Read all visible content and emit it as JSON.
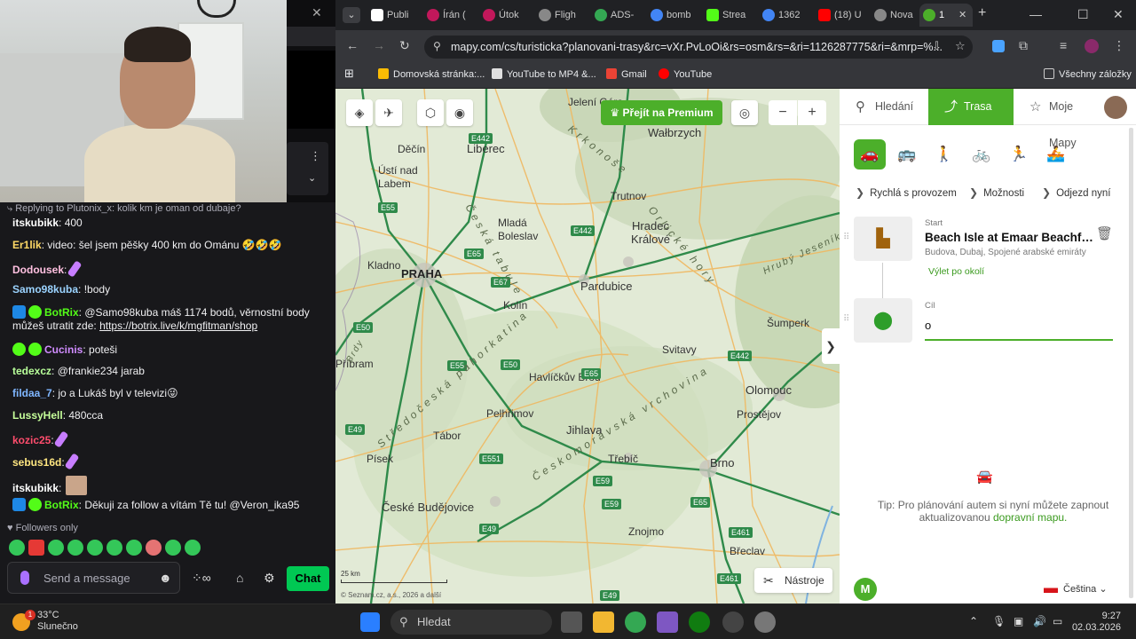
{
  "chat": {
    "reply_context": "Replying to Plutonix_x: kolik km je oman od dubaje?",
    "messages": [
      {
        "user": "itskubikk",
        "color": "#ffffff",
        "text": "400"
      },
      {
        "user": "Er1lik",
        "color": "#ffd966",
        "text": "video: šel jsem pěšky 400 km do Ománu 🤣🤣🤣"
      },
      {
        "user": "Dodousek",
        "color": "#ffc0e0",
        "text": ""
      },
      {
        "user": "Samo98kuba",
        "color": "#9bd3ff",
        "text": "!body"
      },
      {
        "user": "BotRix",
        "color": "#53fc18",
        "text": "@Samo98kuba máš 1174 bodů, věrnostní body můžeš utratit zde:",
        "link": "https://botrix.live/k/mgfitman/shop"
      },
      {
        "user": "Cucinis",
        "color": "#d08cff",
        "text": "poteši"
      },
      {
        "user": "tedexcz",
        "color": "#b8ff9a",
        "text": "@frankie234 jarab"
      },
      {
        "user": "fildaa_7",
        "color": "#7fb6ff",
        "text": "jo a Lukáš byl v televizi😜"
      },
      {
        "user": "LussyHell",
        "color": "#c6ff9a",
        "text": "480cca"
      },
      {
        "user": "kozic25",
        "color": "#ff4d6d",
        "text": ""
      },
      {
        "user": "sebus16d",
        "color": "#ffe680",
        "text": ""
      },
      {
        "user": "itskubikk",
        "color": "#ffffff",
        "text": ""
      },
      {
        "user": "BotRix",
        "color": "#53fc18",
        "text": "Děkuji za follow a vítám Tě tu! @Veron_ika95"
      }
    ],
    "followers_only": "Followers only",
    "send_placeholder": "Send a message",
    "chat_button": "Chat"
  },
  "browser": {
    "tabs": [
      {
        "label": "Publi",
        "color": "#ffffff"
      },
      {
        "label": "Írán (",
        "color": "#c2185b"
      },
      {
        "label": "Útok",
        "color": "#c2185b"
      },
      {
        "label": "Fligh",
        "color": "#888888"
      },
      {
        "label": "ADS-",
        "color": "#34a853"
      },
      {
        "label": "bomb",
        "color": "#4285f4"
      },
      {
        "label": "Strea",
        "color": "#53fc18"
      },
      {
        "label": "1362",
        "color": "#4285f4"
      },
      {
        "label": "(18) U",
        "color": "#ff0000"
      },
      {
        "label": "Nova",
        "color": "#888888"
      },
      {
        "label": "1",
        "color": "#4caf2a"
      }
    ],
    "url": "mapy.com/cs/turisticka?planovani-trasy&rc=vXr.PvLoOi&rs=osm&rs=&ri=1126287775&ri=&mrp=%...",
    "bookmarks": [
      "Domovská stránka:...",
      "YouTube to MP4 &...",
      "Gmail",
      "YouTube"
    ],
    "all_bookmarks": "Všechny záložky"
  },
  "map": {
    "premium_label": "Přejít na Premium",
    "tools_label": "Nástroje",
    "copyright": "© Seznam.cz, a.s., 2026 a další",
    "scale": "25 km",
    "cities": [
      {
        "name": "PRAHA",
        "cls": "big"
      },
      {
        "name": "Liberec",
        "cls": "med"
      },
      {
        "name": "Pardubice",
        "cls": "med"
      },
      {
        "name": "Hradec Králové",
        "cls": "med"
      },
      {
        "name": "Olomouc",
        "cls": "med"
      },
      {
        "name": "Jihlava",
        "cls": "med"
      },
      {
        "name": "Brno",
        "cls": "med"
      },
      {
        "name": "České Budějovice",
        "cls": "med"
      },
      {
        "name": "Wałbrzych",
        "cls": "med"
      },
      {
        "name": "Jelení Góra",
        "cls": ""
      },
      {
        "name": "Děčín",
        "cls": ""
      },
      {
        "name": "Ústí nad Labem",
        "cls": ""
      },
      {
        "name": "Mladá Boleslav",
        "cls": ""
      },
      {
        "name": "Trutnov",
        "cls": ""
      },
      {
        "name": "Kladno",
        "cls": ""
      },
      {
        "name": "Kolín",
        "cls": ""
      },
      {
        "name": "Šumperk",
        "cls": ""
      },
      {
        "name": "Svitavy",
        "cls": ""
      },
      {
        "name": "Příbram",
        "cls": ""
      },
      {
        "name": "Havlíčkův Brod",
        "cls": ""
      },
      {
        "name": "Pelhřimov",
        "cls": ""
      },
      {
        "name": "Prostějov",
        "cls": ""
      },
      {
        "name": "Tábor",
        "cls": ""
      },
      {
        "name": "Písek",
        "cls": ""
      },
      {
        "name": "Třebíč",
        "cls": ""
      },
      {
        "name": "Znojmo",
        "cls": ""
      },
      {
        "name": "Břeclav",
        "cls": ""
      }
    ],
    "roads": [
      "E442",
      "E55",
      "E65",
      "E67",
      "E442",
      "E50",
      "E55",
      "E50",
      "E65",
      "E442",
      "E49",
      "E551",
      "E59",
      "E49",
      "E59",
      "E461",
      "E461",
      "E49",
      "E65"
    ],
    "regions": [
      "Krkonoše",
      "Orlické hory",
      "Hrubý Jeseník",
      "Česká tabule",
      "Českomoravská vrchovina",
      "Brdy",
      "Středočeská pahorkatina"
    ]
  },
  "panel": {
    "tabs": [
      "Hledání",
      "Trasa",
      "Moje Mapy"
    ],
    "options": [
      "Rychlá s provozem",
      "Možnosti",
      "Odjezd nyní"
    ],
    "start_label": "Start",
    "start_name": "Beach Isle at Emaar Beachfront",
    "start_address": "Budova, Dubaj, Spojené arabské emiráty",
    "trip_nearby": "Výlet po okolí",
    "dest_label": "Cíl",
    "dest_value": "o",
    "tip_text": "Tip: Pro plánování autem si nyní můžete zapnout aktualizovanou",
    "tip_link": "dopravní mapu.",
    "language": "Čeština"
  },
  "taskbar": {
    "temp": "33°C",
    "weather": "Slunečno",
    "search_placeholder": "Hledat",
    "time": "9:27",
    "date": "02.03.2026",
    "weather_badge": "1"
  }
}
